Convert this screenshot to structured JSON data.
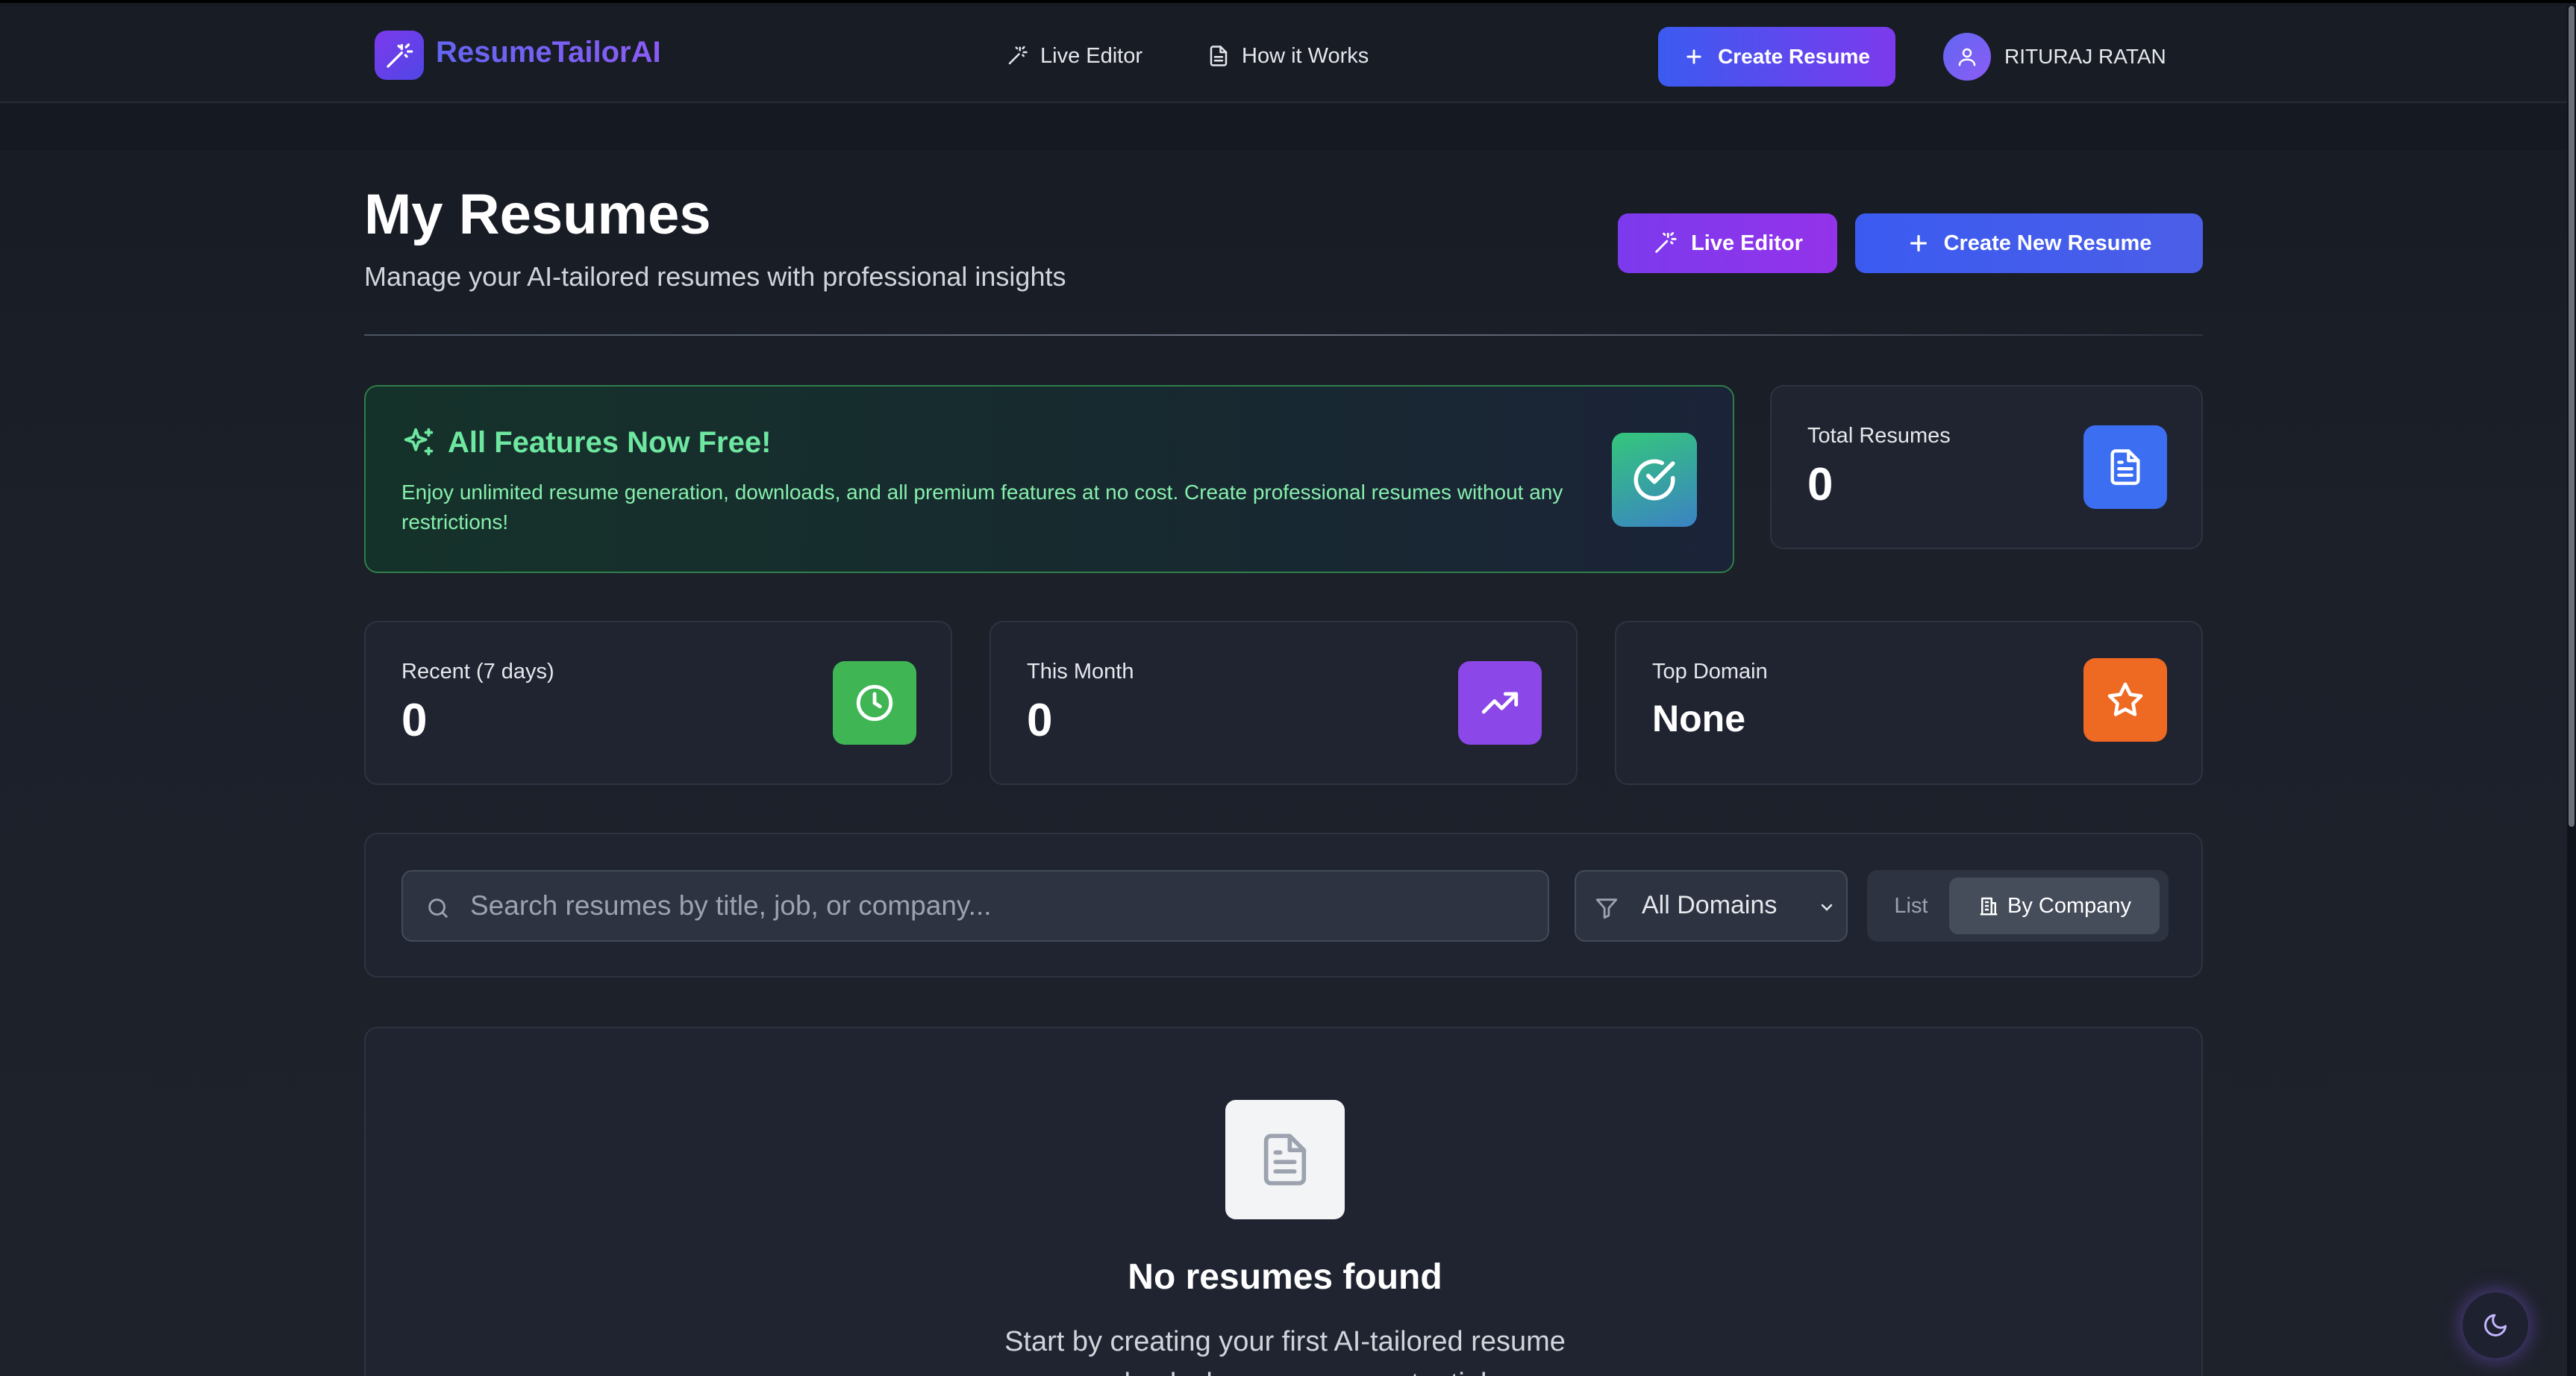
{
  "header": {
    "brand": "ResumeTailorAI",
    "nav": [
      {
        "label": "Live Editor",
        "icon": "wand-sparkles-icon"
      },
      {
        "label": "How it Works",
        "icon": "document-icon"
      }
    ],
    "create_button": "Create Resume",
    "user_name": "RITURAJ RATAN"
  },
  "page": {
    "title": "My Resumes",
    "subtitle": "Manage your AI-tailored resumes with professional insights",
    "live_editor_button": "Live Editor",
    "create_new_button": "Create New Resume"
  },
  "promo": {
    "title": "All Features Now Free!",
    "text": "Enjoy unlimited resume generation, downloads, and all premium features at no cost. Create professional resumes without any restrictions!"
  },
  "stats": {
    "total": {
      "label": "Total Resumes",
      "value": "0",
      "color": "#3b6ef0"
    },
    "recent": {
      "label": "Recent (7 days)",
      "value": "0",
      "color": "#3fb554"
    },
    "month": {
      "label": "This Month",
      "value": "0",
      "color": "#8b47e8"
    },
    "top_domain": {
      "label": "Top Domain",
      "value": "None",
      "color": "#ee6a22"
    }
  },
  "filters": {
    "search_placeholder": "Search resumes by title, job, or company...",
    "domain_selected": "All Domains",
    "view_list": "List",
    "view_company": "By Company"
  },
  "empty": {
    "title": "No resumes found",
    "text": "Start by creating your first AI-tailored resume and unlock your career potential"
  },
  "colors": {
    "accent_blue": "#3b5bf0",
    "accent_purple": "#7c3aed",
    "success_green": "#6ee7a0",
    "background": "#1a1e27"
  }
}
